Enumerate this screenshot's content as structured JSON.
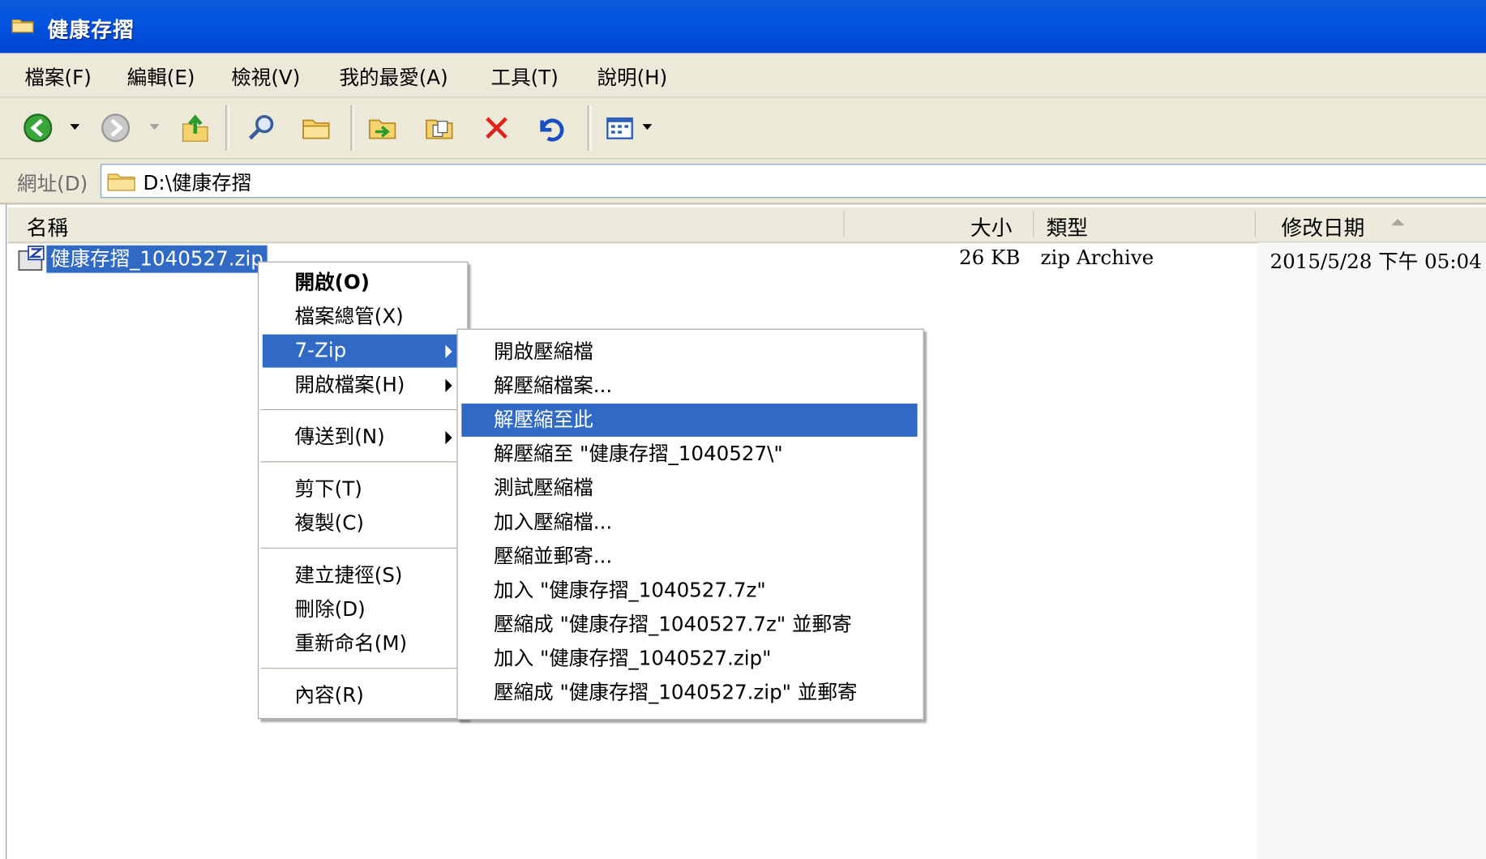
{
  "window": {
    "title": "健康存摺"
  },
  "menubar": [
    {
      "label": "檔案(F)"
    },
    {
      "label": "編輯(E)"
    },
    {
      "label": "檢視(V)"
    },
    {
      "label": "我的最愛(A)"
    },
    {
      "label": "工具(T)"
    },
    {
      "label": "說明(H)"
    }
  ],
  "toolbar": {
    "icons": [
      "back-icon",
      "forward-icon",
      "up-folder-icon",
      "search-icon",
      "folders-icon",
      "move-to-icon",
      "copy-to-icon",
      "delete-icon",
      "undo-icon",
      "views-icon"
    ]
  },
  "address": {
    "label": "網址(D)",
    "path": "D:\\健康存摺"
  },
  "columns": {
    "name": "名稱",
    "size": "大小",
    "type": "類型",
    "modified": "修改日期"
  },
  "files": [
    {
      "name": "健康存摺_1040527.zip",
      "size": "26 KB",
      "type": "zip Archive",
      "modified": "2015/5/28 下午 05:04"
    }
  ],
  "context_menu": [
    {
      "label": "開啟(O)"
    },
    {
      "label": "檔案總管(X)"
    },
    {
      "label": "7-Zip"
    },
    {
      "label": "開啟檔案(H)"
    },
    {
      "label": "傳送到(N)"
    },
    {
      "label": "剪下(T)"
    },
    {
      "label": "複製(C)"
    },
    {
      "label": "建立捷徑(S)"
    },
    {
      "label": "刪除(D)"
    },
    {
      "label": "重新命名(M)"
    },
    {
      "label": "內容(R)"
    }
  ],
  "submenu_7zip": [
    {
      "label": "開啟壓縮檔"
    },
    {
      "label": "解壓縮檔案..."
    },
    {
      "label": "解壓縮至此"
    },
    {
      "label": "解壓縮至 \"健康存摺_1040527\\\""
    },
    {
      "label": "測試壓縮檔"
    },
    {
      "label": "加入壓縮檔..."
    },
    {
      "label": "壓縮並郵寄..."
    },
    {
      "label": "加入 \"健康存摺_1040527.7z\""
    },
    {
      "label": "壓縮成 \"健康存摺_1040527.7z\" 並郵寄"
    },
    {
      "label": "加入 \"健康存摺_1040527.zip\""
    },
    {
      "label": "壓縮成 \"健康存摺_1040527.zip\" 並郵寄"
    }
  ],
  "colors": {
    "titlebar": "#0254df",
    "highlight": "#316ac5",
    "chrome": "#ece9d8"
  }
}
